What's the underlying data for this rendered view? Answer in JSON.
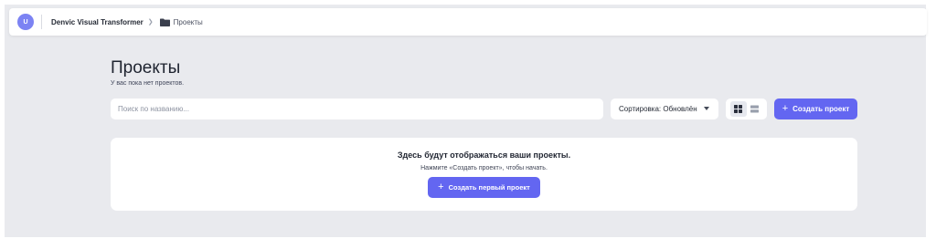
{
  "header": {
    "avatar_initial": "U",
    "app_name": "Denvic Visual Transformer",
    "current_page": "Проекты"
  },
  "main": {
    "title": "Проекты",
    "subtitle": "У вас пока нет проектов.",
    "search": {
      "placeholder": "Поиск по названию..."
    },
    "sort": {
      "label": "Сортировка: Обновлён"
    },
    "create_button": "Создать проект",
    "empty_state": {
      "title": "Здесь будут отображаться ваши проекты.",
      "hint": "Нажмите «Создать проект», чтобы начать.",
      "button": "Создать первый проект"
    }
  },
  "colors": {
    "accent": "#6366f1",
    "avatar": "#7c83f3",
    "background": "#e9eaee"
  },
  "icons": {
    "breadcrumb": "folder-icon",
    "chevron": "chevron-right-icon",
    "grid_view": "grid-icon",
    "list_view": "list-icon",
    "add": "plus-icon",
    "sort": "caret-down-icon"
  }
}
